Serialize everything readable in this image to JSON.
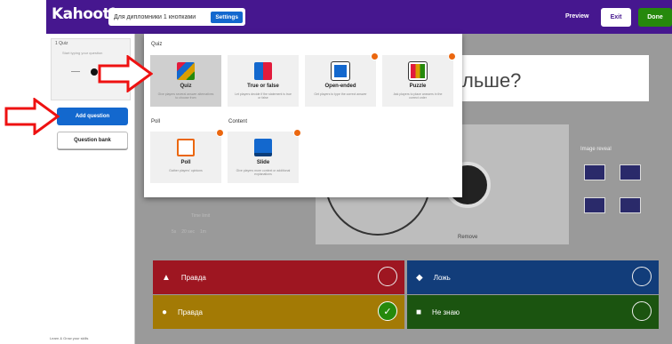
{
  "topbar": {
    "logo": "Kahoot!",
    "quiz_title": "Для дипломники 1 кнопками",
    "settings": "Settings",
    "preview": "Preview",
    "exit": "Exit",
    "done": "Done"
  },
  "sidebar": {
    "card_label": "1 Quiz",
    "card_text": "Start typing your question",
    "add_question": "Add question",
    "question_bank": "Question bank",
    "footer": "Learn & Grow your skills"
  },
  "main": {
    "question_text": "льше?",
    "remove": "Remove",
    "image_reveal": "Image reveal",
    "time_limit": "Time limit",
    "timer_values": [
      "5s",
      "20 sec",
      "1m"
    ]
  },
  "answers": [
    {
      "shape": "▲",
      "text": "Правда",
      "correct": false
    },
    {
      "shape": "◆",
      "text": "Ложь",
      "correct": false
    },
    {
      "shape": "●",
      "text": "Правда",
      "correct": true
    },
    {
      "shape": "■",
      "text": "Не знаю",
      "correct": false
    }
  ],
  "modal": {
    "section_quiz": "Quiz",
    "section_poll": "Poll",
    "section_content": "Content",
    "tiles": {
      "quiz": {
        "name": "Quiz",
        "desc": "Give players several answer alternatives to choose from"
      },
      "true_false": {
        "name": "True or false",
        "desc": "Let players decide if the statement is true or false"
      },
      "open_ended": {
        "name": "Open-ended",
        "desc": "Get players to type the correct answer"
      },
      "puzzle": {
        "name": "Puzzle",
        "desc": "Ask players to place answers in the correct order"
      },
      "poll": {
        "name": "Poll",
        "desc": "Gather players' opinions"
      },
      "slide": {
        "name": "Slide",
        "desc": "Give players more context or additional explanations"
      }
    }
  },
  "colors": {
    "brand": "#46178f",
    "blue": "#1368ce",
    "green": "#26890c",
    "red": "#e21b3c",
    "orange": "#eb670f",
    "arrow": "#e11"
  }
}
